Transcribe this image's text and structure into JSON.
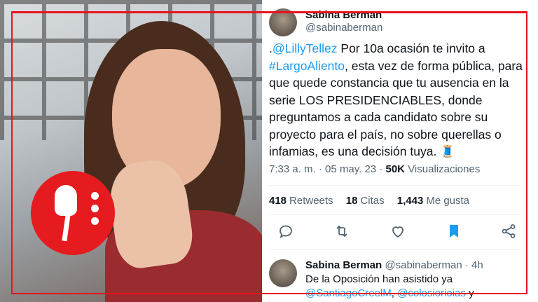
{
  "tweet": {
    "author_name": "Sabina Berman",
    "author_handle": "@sabinaberman",
    "text_parts": {
      "p1": ".",
      "mention1": "@LillyTellez",
      "p2": " Por 10a ocasión te invito a ",
      "hashtag": "#LargoAliento",
      "p3": ", esta vez de forma pública, para que quede constancia que tu ausencia en la serie LOS PRESIDENCIABLES, donde preguntamos a cada candidato sobre su proyecto para el país, no sobre querellas o infamias, es una decisión tuya. 🧵"
    },
    "time": "7:33 a. m.",
    "date": "05 may. 23",
    "views_count": "50K",
    "views_label": "Visualizaciones",
    "retweets_count": "418",
    "retweets_label": "Retweets",
    "quotes_count": "18",
    "quotes_label": "Citas",
    "likes_count": "1,443",
    "likes_label": "Me gusta",
    "icons": [
      "reply-icon",
      "retweet-icon",
      "like-icon",
      "bookmark-icon",
      "share-icon"
    ],
    "accent_color": "#1d9bf0",
    "bookmark_color": "#1d9bf0"
  },
  "reply": {
    "author_name": "Sabina Berman",
    "author_handle": "@sabinaberman",
    "time": "· 4h",
    "line1": "De la Oposición han asistido ya",
    "mention1": "@SantiagoCreelM",
    "sep": ", ",
    "mention2": "@colosiorioias",
    "tail": " y"
  },
  "frame_color": "#e8141e"
}
